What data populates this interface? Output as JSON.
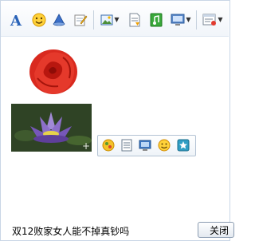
{
  "toolbar": {
    "buttons": [
      {
        "id": "font",
        "icon": "font-icon"
      },
      {
        "id": "emoticon",
        "icon": "smiley-icon"
      },
      {
        "id": "nudge",
        "icon": "bell-icon"
      },
      {
        "id": "note",
        "icon": "note-pencil-icon"
      },
      {
        "id": "image",
        "icon": "image-icon",
        "has_dropdown": true
      },
      {
        "id": "file",
        "icon": "file-icon"
      },
      {
        "id": "music",
        "icon": "music-icon"
      },
      {
        "id": "screen",
        "icon": "screen-capture-icon",
        "has_dropdown": true
      },
      {
        "id": "history",
        "icon": "message-history-icon",
        "has_dropdown": true
      }
    ]
  },
  "content": {
    "images": [
      {
        "name": "rose",
        "icon": "rose-image"
      },
      {
        "name": "lotus",
        "icon": "lotus-image"
      }
    ],
    "image_popup_toolbar": [
      {
        "icon": "magic-icon"
      },
      {
        "icon": "save-icon"
      },
      {
        "icon": "screen-icon"
      },
      {
        "icon": "emoticon-add-icon"
      },
      {
        "icon": "star-icon"
      }
    ]
  },
  "status": {
    "text": "双12败家女人能不掉真钞吗",
    "close_label": "关闭"
  },
  "colors": {
    "toolbar_bg": "#f1f5fa",
    "border": "#c9d6e6"
  }
}
